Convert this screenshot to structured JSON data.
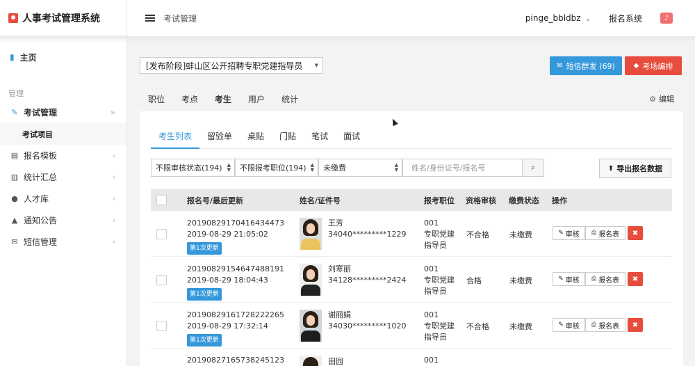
{
  "brand": {
    "title": "人事考试管理系统"
  },
  "sidebar": {
    "home": "主页",
    "section": "管理",
    "items": [
      {
        "label": "考试管理",
        "icon": "edit-icon"
      },
      {
        "label": "报名模板",
        "icon": "id-card-icon"
      },
      {
        "label": "统计汇总",
        "icon": "bar-chart-icon"
      },
      {
        "label": "人才库",
        "icon": "users-icon"
      },
      {
        "label": "通知公告",
        "icon": "bell-icon"
      },
      {
        "label": "短信管理",
        "icon": "envelope-icon"
      }
    ],
    "sub_item": "考试项目"
  },
  "topbar": {
    "title": "考试管理",
    "user": "pinge_bbldbz",
    "system": "报名系统"
  },
  "project": {
    "selected": "[发布阶段]蚌山区公开招聘专职党建指导员"
  },
  "buttons": {
    "sms": "短信群发 (69)",
    "exam_room": "考场编排",
    "edit": "编辑",
    "export": "导出报名数据"
  },
  "top_tabs": [
    "职位",
    "考点",
    "考生",
    "用户",
    "统计"
  ],
  "sub_tabs": [
    "考生列表",
    "留验单",
    "桌贴",
    "门贴",
    "笔试",
    "面试"
  ],
  "filters": {
    "review": "不限审核状态(194)",
    "position": "不限报考职位(194)",
    "payment": "未缴费",
    "search_placeholder": "姓名/身份证号/报名号"
  },
  "table": {
    "headers": [
      "报名号/最后更新",
      "姓名/证件号",
      "报考职位",
      "资格审核",
      "缴费状态",
      "操作"
    ],
    "actions": {
      "review": "审核",
      "form": "报名表"
    },
    "rows": [
      {
        "reg_no": "20190829170416434473",
        "updated": "2019-08-29 21:05:02",
        "badge": "第1次更新",
        "name": "王芳",
        "id_no": "34040*********1229",
        "pos_code": "001",
        "pos_name1": "专职党建",
        "pos_name2": "指导员",
        "qual": "不合格",
        "pay": "未缴费"
      },
      {
        "reg_no": "20190829154647488191",
        "updated": "2019-08-29 18:04:43",
        "badge": "第1次更新",
        "name": "刘寒丽",
        "id_no": "34128*********2424",
        "pos_code": "001",
        "pos_name1": "专职党建",
        "pos_name2": "指导员",
        "qual": "合格",
        "pay": "未缴费"
      },
      {
        "reg_no": "20190829161728222265",
        "updated": "2019-08-29 17:32:14",
        "badge": "第1次更新",
        "name": "谢丽娟",
        "id_no": "34030*********1020",
        "pos_code": "001",
        "pos_name1": "专职党建",
        "pos_name2": "指导员",
        "qual": "不合格",
        "pay": "未缴费"
      },
      {
        "reg_no": "20190827165738245123",
        "name": "田园",
        "pos_code": "001"
      }
    ]
  }
}
